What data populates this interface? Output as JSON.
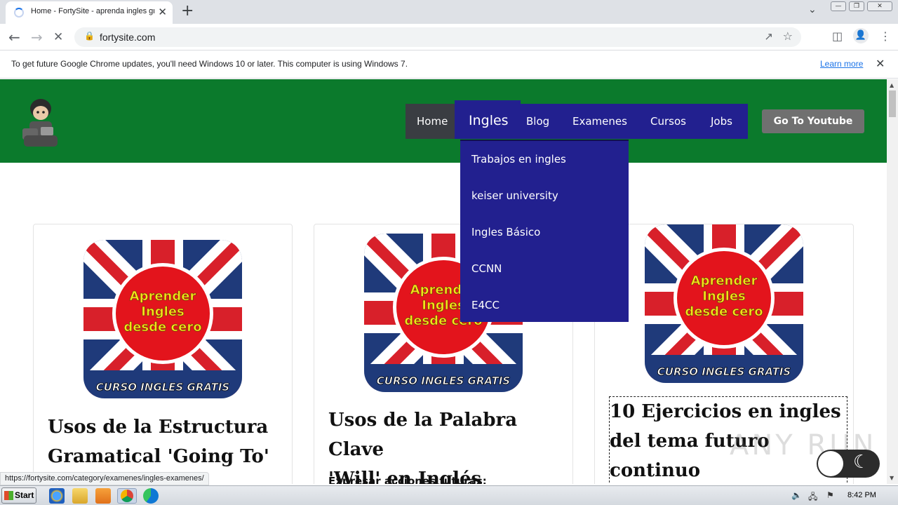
{
  "browser": {
    "tab_title": "Home - FortySite - aprenda ingles gr",
    "url": "fortysite.com",
    "new_tab_glyph": "+",
    "close_glyph": "✕"
  },
  "infobar": {
    "message": "To get future Google Chrome updates, you'll need Windows 10 or later. This computer is using Windows 7.",
    "learn_more": "Learn more"
  },
  "site": {
    "nav": {
      "home": "Home",
      "ingles": "Ingles",
      "blog": "Blog",
      "examenes": "Examenes",
      "cursos": "Cursos",
      "jobs": "Jobs"
    },
    "youtube_button": "Go To Youtube",
    "dropdown": [
      "Trabajos en ingles",
      "keiser university",
      "Ingles Básico",
      "CCNN",
      "E4CC"
    ],
    "colors": {
      "header_bg": "#0b7a2c",
      "nav_bg": "#22208f",
      "home_bg": "#3a3d42"
    }
  },
  "cards": [
    {
      "title_lines": [
        "Usos de la Estructura",
        "Gramatical 'Going To' en"
      ],
      "image_text": [
        "Aprender",
        "Ingles",
        "desde cero",
        "CURSO INGLES GRATIS"
      ]
    },
    {
      "title_lines": [
        "Usos de la Palabra Clave",
        "'Will' en Inglés"
      ],
      "excerpt": "Expresar acciones futuras:",
      "image_text": [
        "Aprender",
        "Ingles",
        "desde cero",
        "CURSO INGLES GRATIS"
      ]
    },
    {
      "title_lines": [
        "10 Ejercicios en ingles",
        "del tema futuro",
        "continuo"
      ],
      "image_text": [
        "Aprender",
        "Ingles",
        "desde cero",
        "CURSO INGLES GRATIS"
      ]
    }
  ],
  "status_url": "https://fortysite.com/category/examenes/ingles-examenes/",
  "watermark": "ANY RUN",
  "taskbar": {
    "start": "Start",
    "clock": "8:42 PM"
  }
}
